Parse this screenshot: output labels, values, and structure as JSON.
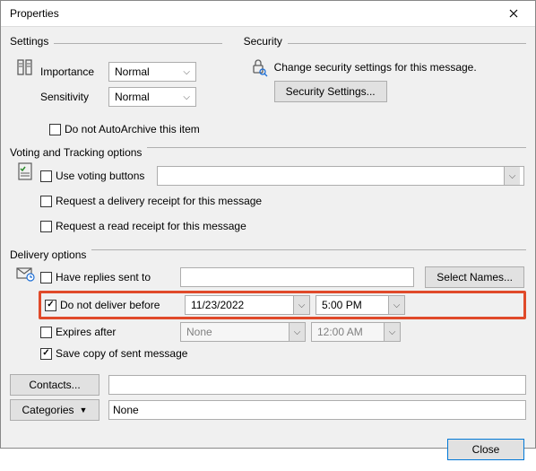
{
  "window": {
    "title": "Properties"
  },
  "settings": {
    "legend": "Settings",
    "importance_label": "Importance",
    "importance_value": "Normal",
    "sensitivity_label": "Sensitivity",
    "sensitivity_value": "Normal",
    "autoarchive_label": "Do not AutoArchive this item",
    "autoarchive_checked": false
  },
  "security": {
    "legend": "Security",
    "description": "Change security settings for this message.",
    "button": "Security Settings..."
  },
  "voting": {
    "legend": "Voting and Tracking options",
    "use_voting_label": "Use voting buttons",
    "use_voting_checked": false,
    "delivery_receipt_label": "Request a delivery receipt for this message",
    "delivery_receipt_checked": false,
    "read_receipt_label": "Request a read receipt for this message",
    "read_receipt_checked": false
  },
  "delivery": {
    "legend": "Delivery options",
    "replies_label": "Have replies sent to",
    "replies_checked": false,
    "replies_value": "",
    "select_names_button": "Select Names...",
    "not_before_label": "Do not deliver before",
    "not_before_checked": true,
    "not_before_date": "11/23/2022",
    "not_before_time": "5:00 PM",
    "expires_label": "Expires after",
    "expires_checked": false,
    "expires_date": "None",
    "expires_time": "12:00 AM",
    "save_copy_label": "Save copy of sent message",
    "save_copy_checked": true
  },
  "bottom": {
    "contacts_button": "Contacts...",
    "contacts_value": "",
    "categories_button": "Categories",
    "categories_value": "None"
  },
  "footer": {
    "close": "Close"
  }
}
